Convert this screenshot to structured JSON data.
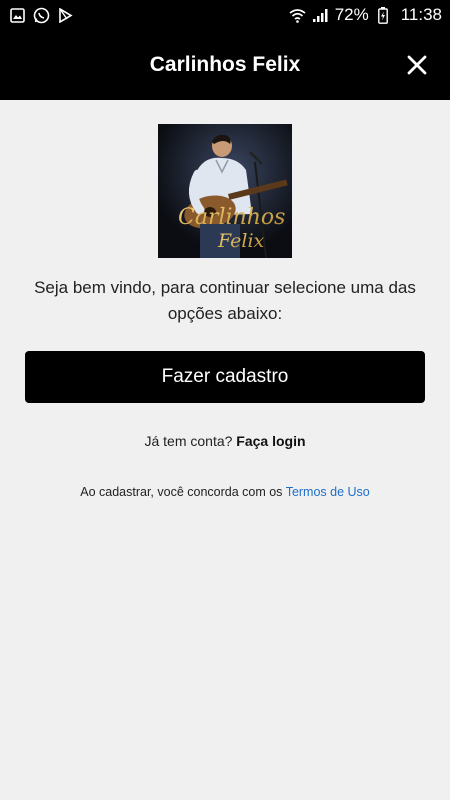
{
  "status_bar": {
    "battery_percent": "72%",
    "time": "11:38"
  },
  "header": {
    "title": "Carlinhos Felix"
  },
  "artist_image": {
    "logo_text_line1": "Carlinhos",
    "logo_text_line2": "Felix"
  },
  "welcome": {
    "message": "Seja bem vindo, para continuar selecione uma das opções abaixo:"
  },
  "signup": {
    "button_label": "Fazer cadastro"
  },
  "login": {
    "prompt": "Já tem conta?",
    "link_label": "Faça login"
  },
  "terms": {
    "prefix": "Ao cadastrar, você concorda com os",
    "link_label": "Termos de Uso"
  },
  "colors": {
    "header_bg": "#000000",
    "background": "#f0f0f0",
    "link": "#1e6fc8"
  }
}
